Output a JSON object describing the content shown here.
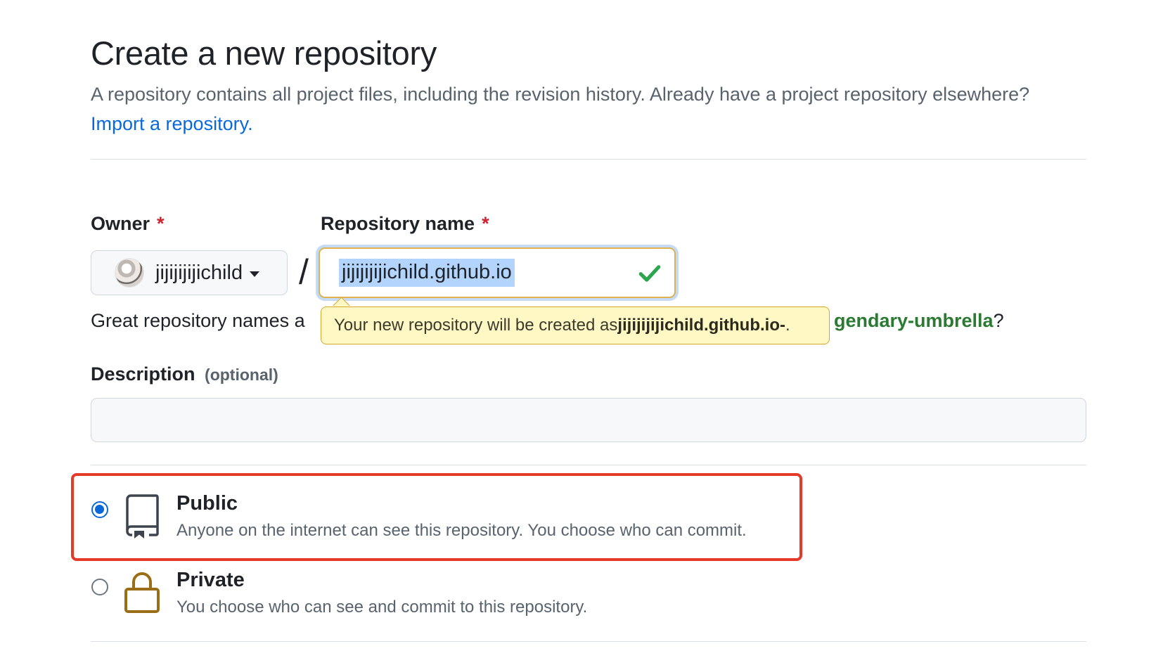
{
  "header": {
    "title": "Create a new repository",
    "subtitle": "A repository contains all project files, including the revision history. Already have a project repository elsewhere?",
    "import_link": "Import a repository."
  },
  "owner": {
    "label": "Owner",
    "required_mark": "*",
    "value": "jijijijijichild"
  },
  "separator": "/",
  "repo_name": {
    "label": "Repository name",
    "required_mark": "*",
    "value": "jijijijijichild.github.io",
    "valid": true
  },
  "hint": {
    "prefix": "Great repository names a",
    "suggestion_tail": "gendary-umbrella",
    "suffix": "?"
  },
  "tooltip": {
    "prefix": "Your new repository will be created as ",
    "name": "jijijijijichild.github.io-",
    "suffix": "."
  },
  "description": {
    "label": "Description",
    "optional": "(optional)",
    "value": ""
  },
  "visibility": {
    "selected": "public",
    "options": [
      {
        "id": "public",
        "title": "Public",
        "description": "Anyone on the internet can see this repository. You choose who can commit.",
        "icon": "repo-icon"
      },
      {
        "id": "private",
        "title": "Private",
        "description": "You choose who can see and commit to this repository.",
        "icon": "lock-icon"
      }
    ]
  },
  "colors": {
    "link": "#0969da",
    "required": "#cf222e",
    "success": "#2da44e",
    "highlight_box": "#e5392a",
    "tooltip_bg": "#fff8c5",
    "lock": "#9a6e17"
  }
}
